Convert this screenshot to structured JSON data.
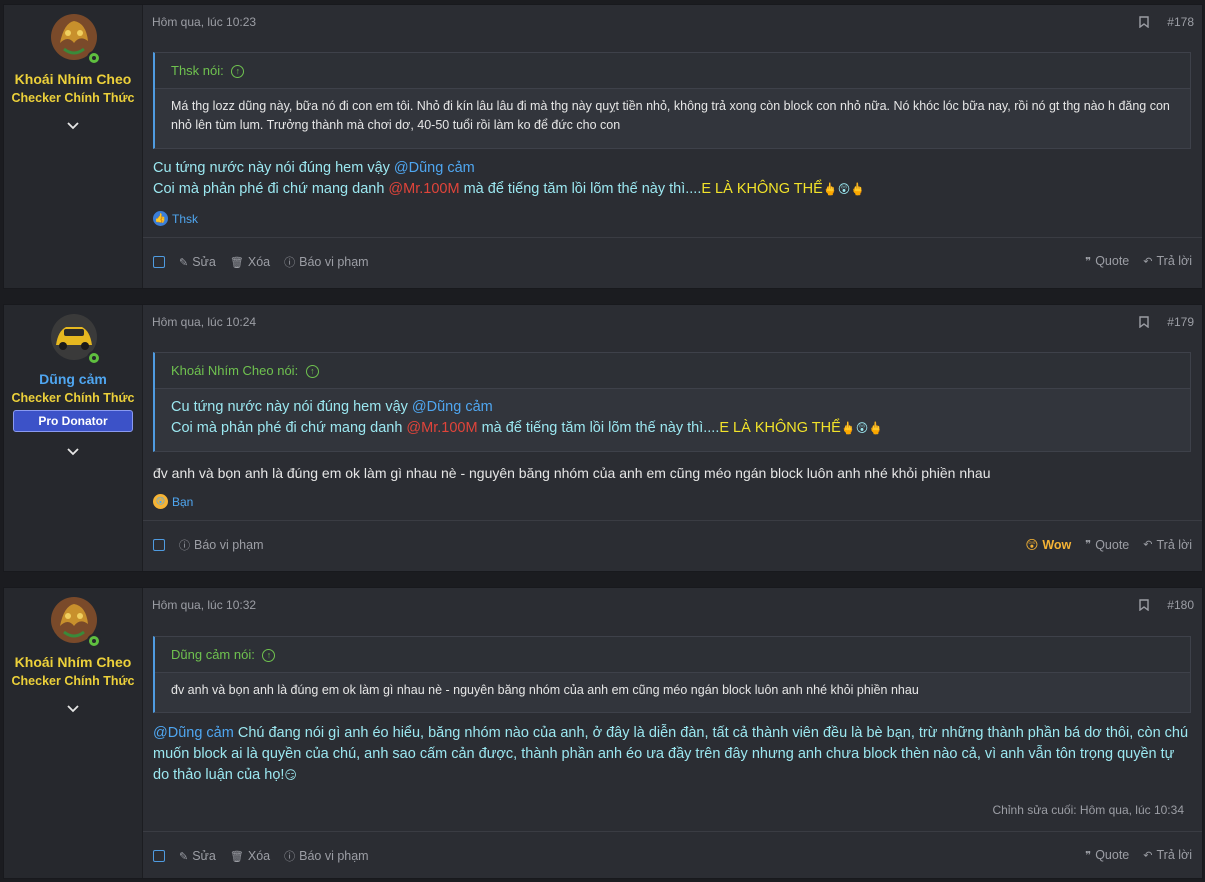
{
  "posts": [
    {
      "user": {
        "name": "Khoái Nhím Cheo",
        "title": "Checker Chính Thức",
        "name_color": "#ecd03a"
      },
      "date": "Hôm qua, lúc 10:23",
      "number": "#178",
      "quote": {
        "author": "Thsk nói:",
        "text": "Má thg lozz dũng này, bữa nó đi con em tôi. Nhỏ đi kín lâu lâu đi mà thg này quỵt tiền nhỏ, không trả xong còn block con nhỏ nữa. Nó khóc lóc bữa nay, rồi nó gt thg nào h đăng con nhỏ lên tùm lum. Trưởng thành mà chơi dơ, 40-50 tuổi rồi làm ko để đức cho con"
      },
      "message": {
        "line1_text": "Cu tứng nước này nói đúng hem vậy ",
        "line1_mention": "@Dũng cảm",
        "line2_a": "Coi mà phản phé đi chứ mang danh ",
        "line2_mention": "@Mr.100M",
        "line2_b": " mà để tiếng tăm lồi lõm thế này thì....",
        "line2_yellow": "E LÀ KHÔNG THỂ",
        "line2_emoji": "🖕😲🖕"
      },
      "reaction": {
        "icon": "like-icon",
        "text": "Thsk"
      },
      "actions_left": [
        "Sửa",
        "Xóa",
        "Báo vi phạm"
      ],
      "actions_right": [
        "Quote",
        "Trả lời"
      ]
    },
    {
      "user": {
        "name": "Dũng cảm",
        "title": "Checker Chính Thức",
        "badge": "Pro Donator",
        "name_color": "#4fa6f0"
      },
      "date": "Hôm qua, lúc 10:24",
      "number": "#179",
      "quote": {
        "author": "Khoái Nhím Cheo nói:",
        "line1_text": "Cu tứng nước này nói đúng hem vậy ",
        "line1_mention": "@Dũng cảm",
        "line2_a": "Coi mà phản phé đi chứ mang danh ",
        "line2_mention": "@Mr.100M",
        "line2_b": " mà để tiếng tăm lồi lõm thế này thì....",
        "line2_yellow": "E LÀ KHÔNG THỂ",
        "line2_emoji": "🖕😲🖕"
      },
      "message": {
        "text": "đv anh và bọn anh là đúng em ok làm gì nhau nè - nguyên băng nhóm của anh em cũng méo ngán block luôn anh nhé khỏi phiền nhau"
      },
      "reaction": {
        "icon": "wow-icon",
        "text": "Bạn"
      },
      "actions_left": [
        "Báo vi phạm"
      ],
      "actions_right": [
        "Wow",
        "Quote",
        "Trả lời"
      ]
    },
    {
      "user": {
        "name": "Khoái Nhím Cheo",
        "title": "Checker Chính Thức",
        "name_color": "#ecd03a"
      },
      "date": "Hôm qua, lúc 10:32",
      "number": "#180",
      "quote": {
        "author": "Dũng cảm nói:",
        "text": "đv anh và bọn anh là đúng em ok làm gì nhau nè - nguyên băng nhóm của anh em cũng méo ngán block luôn anh nhé khỏi phiền nhau"
      },
      "message": {
        "mention": "@Dũng cảm",
        "text": " Chú đang nói gì anh éo hiểu, băng nhóm nào của anh, ở đây là diễn đàn, tất cả thành viên đều là bè bạn, trừ những thành phần bá dơ thôi, còn chú muốn block ai là quyền của chú, anh sao cấm cản được, thành phần anh éo ưa đầy trên đây nhưng anh chưa block thèn nào cả, vì anh vẫn tôn trọng quyền tự do thảo luận của họ!",
        "emoji": "😏"
      },
      "edited": "Chỉnh sửa cuối: Hôm qua, lúc 10:34",
      "actions_left": [
        "Sửa",
        "Xóa",
        "Báo vi phạm"
      ],
      "actions_right": [
        "Quote",
        "Trả lời"
      ]
    }
  ]
}
